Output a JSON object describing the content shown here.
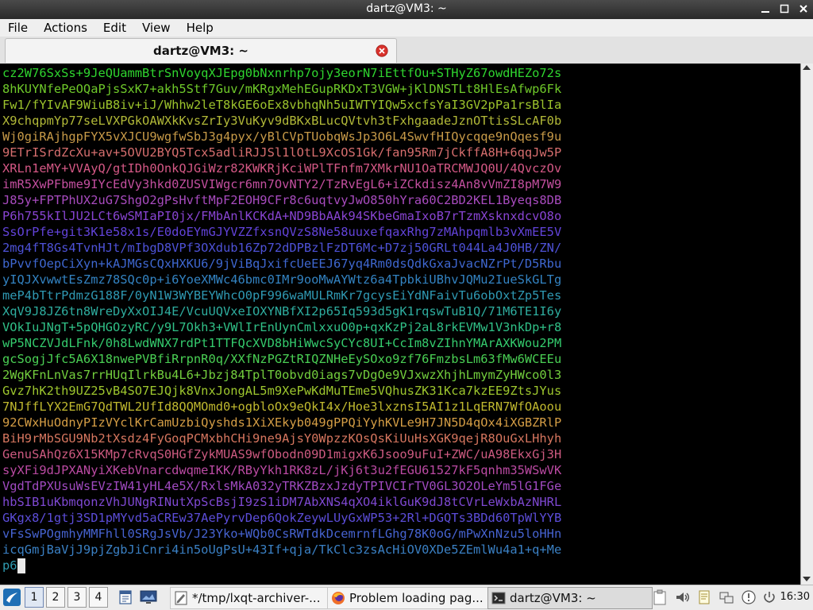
{
  "window": {
    "title": "dartz@VM3: ~"
  },
  "menu": [
    "File",
    "Actions",
    "Edit",
    "View",
    "Help"
  ],
  "tab": {
    "label": "dartz@VM3: ~"
  },
  "terminal": {
    "lines": [
      "cz2W76SxSs+9JeQUammBtrSnVoyqXJEpg0bNxnrhp7ojy3eorN7iEttfOu+STHyZ67owdHEZo72s",
      "8hKUYNfePeOQaPjsSxK7+akh5Stf7Guv/mKRgxMehEGupRKDxT3VGW+jKlDNSTLt8HlEsAfwp6Fk",
      "Fw1/fYIvAF9WiuB8iv+iJ/Whhw2leT8kGE6oEx8vbhqNh5uIWTYIQw5xcfsYaI3GV2pPa1rsBlIa",
      "X9chqpmYp77seLVXPGkOAWXkKvsZrIy3VuKyv9dBKxBLucQVtvh3tFxhgaadeJznOTtisSLcAF0b",
      "Wj0giRAjhgpFYX5vXJCU9wgfwSbJ3g4pyx/yBlCVpTUobqWsJp3O6L4SwvfHIQycqqe9nQqesf9u",
      "9ETrISrdZcXu+av+5OVU2BYQ5Tcx5adliRJJSl1lOtL9XcOS1Gk/fan95Rm7jCkffA8H+6qqJw5P",
      "XRLn1eMY+VVAyQ/gtIDh0OnkQJGiWzr82KWKRjKciWPlTFnfm7XMkrNU1OaTRCMWJQ0U/4QvczOv",
      "imR5XwPFbme9IYcEdVy3hkd0ZUSVIWgcr6mn7OvNTY2/TzRvEgL6+iZCkdisz4An8vVmZI8pM7W9",
      "J85y+FPTPhUX2uG7ShgO2gPsHvftMpF2EOH9CFr8c6uqtvyJwO850hYra60C2BD2KEL1Byeqs8DB",
      "P6h755kIlJU2LCt6wSMIaPI0jx/FMbAnlKCKdA+ND9BbAAk94SKbeGmaIxoB7rTzmXsknxdcvO8o",
      "SsOrPfe+git3K1e58x1s/E0doEYmGJYVZZfxsnQVzS8Ne58uuxefqaxRhg7zMAhpqmlb3vXmEE5V",
      "2mg4fT8Gs4TvnHJt/mIbgD8VPf3OXdub16Zp72dDPBzlFzDT6Mc+D7zj50GRLt044La4J0HB/ZN/",
      "bPvvfOepCiXyn+kAJMGsCQxHXKU6/9jViBqJxifcUeEEJ67yq4Rm0dsQdkGxaJvacNZrPt/D5Rbu",
      "yIQJXvwwtEsZmz78SQc0p+i6YoeXMWc46bmc0IMr9ooMwAYWtz6a4TpbkiUBhvJQMu2IueSkGLTg",
      "meP4bTtrPdmzG188F/0yN1W3WYBEYWhcO0pF996waMULRmKr7gcysEiYdNFaivTu6obOxtZp5Tes",
      "XqV9J8JZ6tn8WreDyXxOIJ4E/VcuUQVxeIOXYNBfXI2p65Iq593d5gK1rqswTuB1Q/71M6TE1I6y",
      "VOkIuJNgT+5pQHGOzyRC/y9L7Okh3+VWlIrEnUynCmlxxuO0p+qxKzPj2aL8rkEVMw1V3nkDp+r8",
      "wP5NCZVJdLFnk/0h8LwdWNX7rdPt1TTFQcXVD8bHiWwcSyCYc8UI+CcIm8vZIhnYMArAXKWou2PM",
      "gcSogjJfc5A6X18nwePVBfiRrpnR0q/XXfNzPGZtRIQZNHeEySOxo9zf76FmzbsLm63fMw6WCEEu",
      "2WgKFnLnVas7rrHUqIlrkBu4L6+Jbzj84TplT0obvd0iags7vDgOe9VJxwzXhjhLmymZyHWco0l3",
      "Gvz7hK2th9UZ25vB4SO7EJQjk8VnxJongAL5m9XePwKdMuTEme5VQhusZK31Kca7kzEE9ZtsJYus",
      "7NJffLYX2EmG7QdTWL2UfId8QQMOmd0+ogbloOx9eQkI4x/Hoe3lxznsI5AI1z1LqERN7WfOAoou",
      "92CWxHuOdnyPIzVYclKrCamUzbiQyshds1XiXEkyb049gPPQiYyhKVLe9H7JN5D4qOx4iXGBZRlP",
      "BiH9rMbSGU9Nb2tXsdz4FyGoqPCMxbhCHi9ne9AjsY0WpzzKOsQsKiUuHsXGK9qejR8OuGxLHhyh",
      "GenuSAhQz6X15KMp7cRvqS0HGfZykMUAS9wfObodn09D1migxK6Jsoo9uFuI+ZWC/uA98EkxGj3H",
      "syXFi9dJPXANyiXKebVnarcdwqmeIKK/RByYkh1RK8zL/jKj6t3u2fEGU61527kF5qnhm35WSwVK",
      "VgdTdPXUsuWsEVzIW41yHL4e5X/RxlsMkA032yTRKZBzxJzdyTPIVCIrTV0GL3O2OLeYm5lG1FGe",
      "hbSIB1uKbmqonzVhJUNgRINutXpScBsjI9zS1iDM7AbXNS4qXO4iklGuK9dJ8tCVrLeWxbAzNHRL",
      "GKgx8/1gtj3SD1pMYvd5aCREw37AePyrvDep6QokZeywLUyGxWP53+2Rl+DGQTs3BDd60TpWlYYB",
      "vFsSwPOgmhyMMFhll0SRgJsVb/J23Yko+WQb0CsRWTdkDcemrnfLGhg78K0oG/mPwXnNzu5loHHn",
      "icqGmjBaVjJ9pjZgbJiCnri4in5oUgPsU+43If+qja/TkClc3zsAcHiOV0XDe5ZEmlWu4a1+q+Me",
      "p6"
    ],
    "line_colors": [
      "#2fd52f",
      "#6fc92a",
      "#9cc32c",
      "#b2b938",
      "#c79a48",
      "#d66e6e",
      "#d45885",
      "#c34f9f",
      "#a84bbf",
      "#8844d2",
      "#6243da",
      "#4e52d8",
      "#3e67d0",
      "#3383c2",
      "#2f99b3",
      "#2ead9f",
      "#30c087",
      "#34cb6d",
      "#4ad054",
      "#73ce3d",
      "#9ec72e",
      "#c0b92f",
      "#d49d45",
      "#d6765f",
      "#cd5a80",
      "#bb4aa3",
      "#a04ac0",
      "#7e48d2",
      "#5c4dd9",
      "#4663d1",
      "#3a80c4",
      "#2f9cb2",
      "#2fb0a0"
    ]
  },
  "taskbar": {
    "desktops": [
      "1",
      "2",
      "3",
      "4"
    ],
    "tasks": [
      {
        "label": "*/tmp/lxqt-archiver-...",
        "icon": "text-editor-icon"
      },
      {
        "label": "Problem loading pag...",
        "icon": "firefox-icon"
      },
      {
        "label": "dartz@VM3: ~",
        "icon": "terminal-icon"
      }
    ],
    "clock": "16:30"
  }
}
